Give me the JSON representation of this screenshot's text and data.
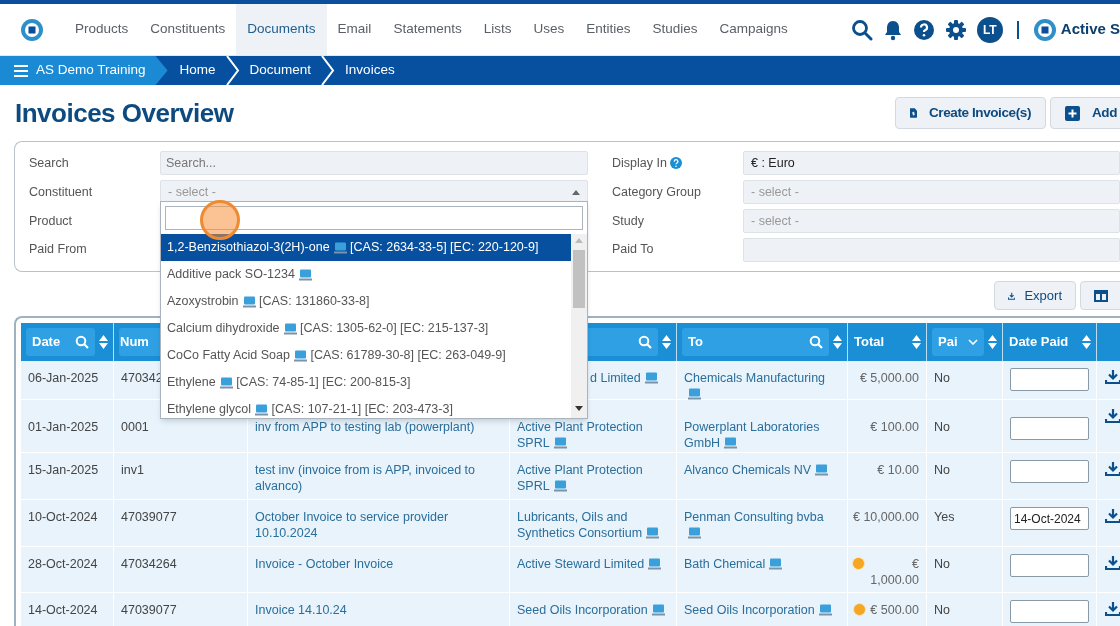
{
  "nav": {
    "items": [
      {
        "label": "Products",
        "selected": false
      },
      {
        "label": "Constituents",
        "selected": false
      },
      {
        "label": "Documents",
        "selected": true
      },
      {
        "label": "Email",
        "selected": false
      },
      {
        "label": "Statements",
        "selected": false
      },
      {
        "label": "Lists",
        "selected": false
      },
      {
        "label": "Uses",
        "selected": false
      },
      {
        "label": "Entities",
        "selected": false
      },
      {
        "label": "Studies",
        "selected": false
      },
      {
        "label": "Campaigns",
        "selected": false
      }
    ],
    "user_initials": "LT",
    "brand": "Active S"
  },
  "breadcrumb": [
    "AS Demo Training",
    "Home",
    "Document",
    "Invoices"
  ],
  "page_title": "Invoices Overview",
  "header_buttons": [
    {
      "label": "Create Invoice(s)",
      "kind": "invoice"
    },
    {
      "label": "Add",
      "kind": "add"
    }
  ],
  "filters_left": [
    {
      "label": "Search",
      "kind": "text",
      "placeholder": "Search..."
    },
    {
      "label": "Constituent",
      "kind": "select",
      "placeholder": "- select -",
      "expanded": true
    },
    {
      "label": "Product",
      "kind": "hidden"
    },
    {
      "label": "Paid From",
      "kind": "hidden"
    }
  ],
  "filters_right": [
    {
      "label": "Display In",
      "kind": "select",
      "value": "€ : Euro",
      "help": true
    },
    {
      "label": "Category Group",
      "kind": "select",
      "placeholder": "- select -"
    },
    {
      "label": "Study",
      "kind": "select",
      "placeholder": "- select -"
    },
    {
      "label": "Paid To",
      "kind": "text"
    }
  ],
  "dropdown_options": [
    {
      "name": "1,2-Benzisothiazol-3(2H)-one",
      "ids": "[CAS: 2634-33-5] [EC: 220-120-9]",
      "selected": true
    },
    {
      "name": "Additive pack SO-1234",
      "selected": false
    },
    {
      "name": "Azoxystrobin",
      "ids": "[CAS: 131860-33-8]",
      "selected": false
    },
    {
      "name": "Calcium dihydroxide",
      "ids": "[CAS: 1305-62-0] [EC: 215-137-3]",
      "selected": false
    },
    {
      "name": "CoCo Fatty Acid Soap",
      "ids": "[CAS: 61789-30-8] [EC: 263-049-9]",
      "selected": false
    },
    {
      "name": "Ethylene",
      "ids": "[CAS: 74-85-1] [EC: 200-815-3]",
      "selected": false
    },
    {
      "name": "Ethylene glycol",
      "ids": "[CAS: 107-21-1] [EC: 203-473-3]",
      "selected": false
    }
  ],
  "toolbar_buttons": [
    {
      "label": "Export",
      "kind": "export"
    },
    {
      "kind": "columns"
    }
  ],
  "table": {
    "columns": [
      {
        "label": "Date",
        "kind": "search",
        "sortable": true
      },
      {
        "label": "Num"
      },
      {},
      {
        "kind": "search",
        "sortable": true
      },
      {
        "label": "To",
        "kind": "search",
        "sortable": true
      },
      {
        "label": "Total",
        "sortable": true
      },
      {
        "label": "Pai",
        "kind": "select",
        "sortable": true
      },
      {
        "label": "Date Paid",
        "sortable": true
      },
      {}
    ],
    "rows": [
      {
        "date": "06-Jan-2025",
        "number": "470342",
        "from": "d Limited",
        "to": "Chemicals Manufacturing",
        "total": "€ 5,000.00",
        "warning": false,
        "paid": "No"
      },
      {
        "date": "01-Jan-2025",
        "number": "0001",
        "description": "inv from APP to testing lab (powerplant)",
        "from": "Active Plant Protection SPRL",
        "to": "Powerplant Laboratories GmbH",
        "total": "€ 100.00",
        "warning": false,
        "paid": "No"
      },
      {
        "date": "15-Jan-2025",
        "number": "inv1",
        "description": "test inv (invoice from is APP, invoiced to alvanco)",
        "from": "Active Plant Protection SPRL",
        "to": "Alvanco Chemicals NV",
        "total": "€ 10.00",
        "warning": false,
        "paid": "No"
      },
      {
        "date": "10-Oct-2024",
        "number": "47039077",
        "description": "October Invoice to service provider 10.10.2024",
        "from": "Lubricants, Oils and Synthetics Consortium",
        "to": "Penman Consulting bvba",
        "total": "€ 10,000.00",
        "warning": false,
        "paid": "Yes",
        "date_paid": "14-Oct-2024"
      },
      {
        "date": "28-Oct-2024",
        "number": "47034264",
        "description": "Invoice - October Invoice",
        "from": "Active Steward Limited",
        "to": "Bath Chemical",
        "total": "€ 1,000.00",
        "warning": true,
        "paid": "No"
      },
      {
        "date": "14-Oct-2024",
        "number": "47039077",
        "description": "Invoice 14.10.24",
        "from": "Seed Oils Incorporation",
        "to": "Seed Oils Incorporation",
        "total": "€ 500.00",
        "warning": true,
        "paid": "No"
      }
    ]
  }
}
